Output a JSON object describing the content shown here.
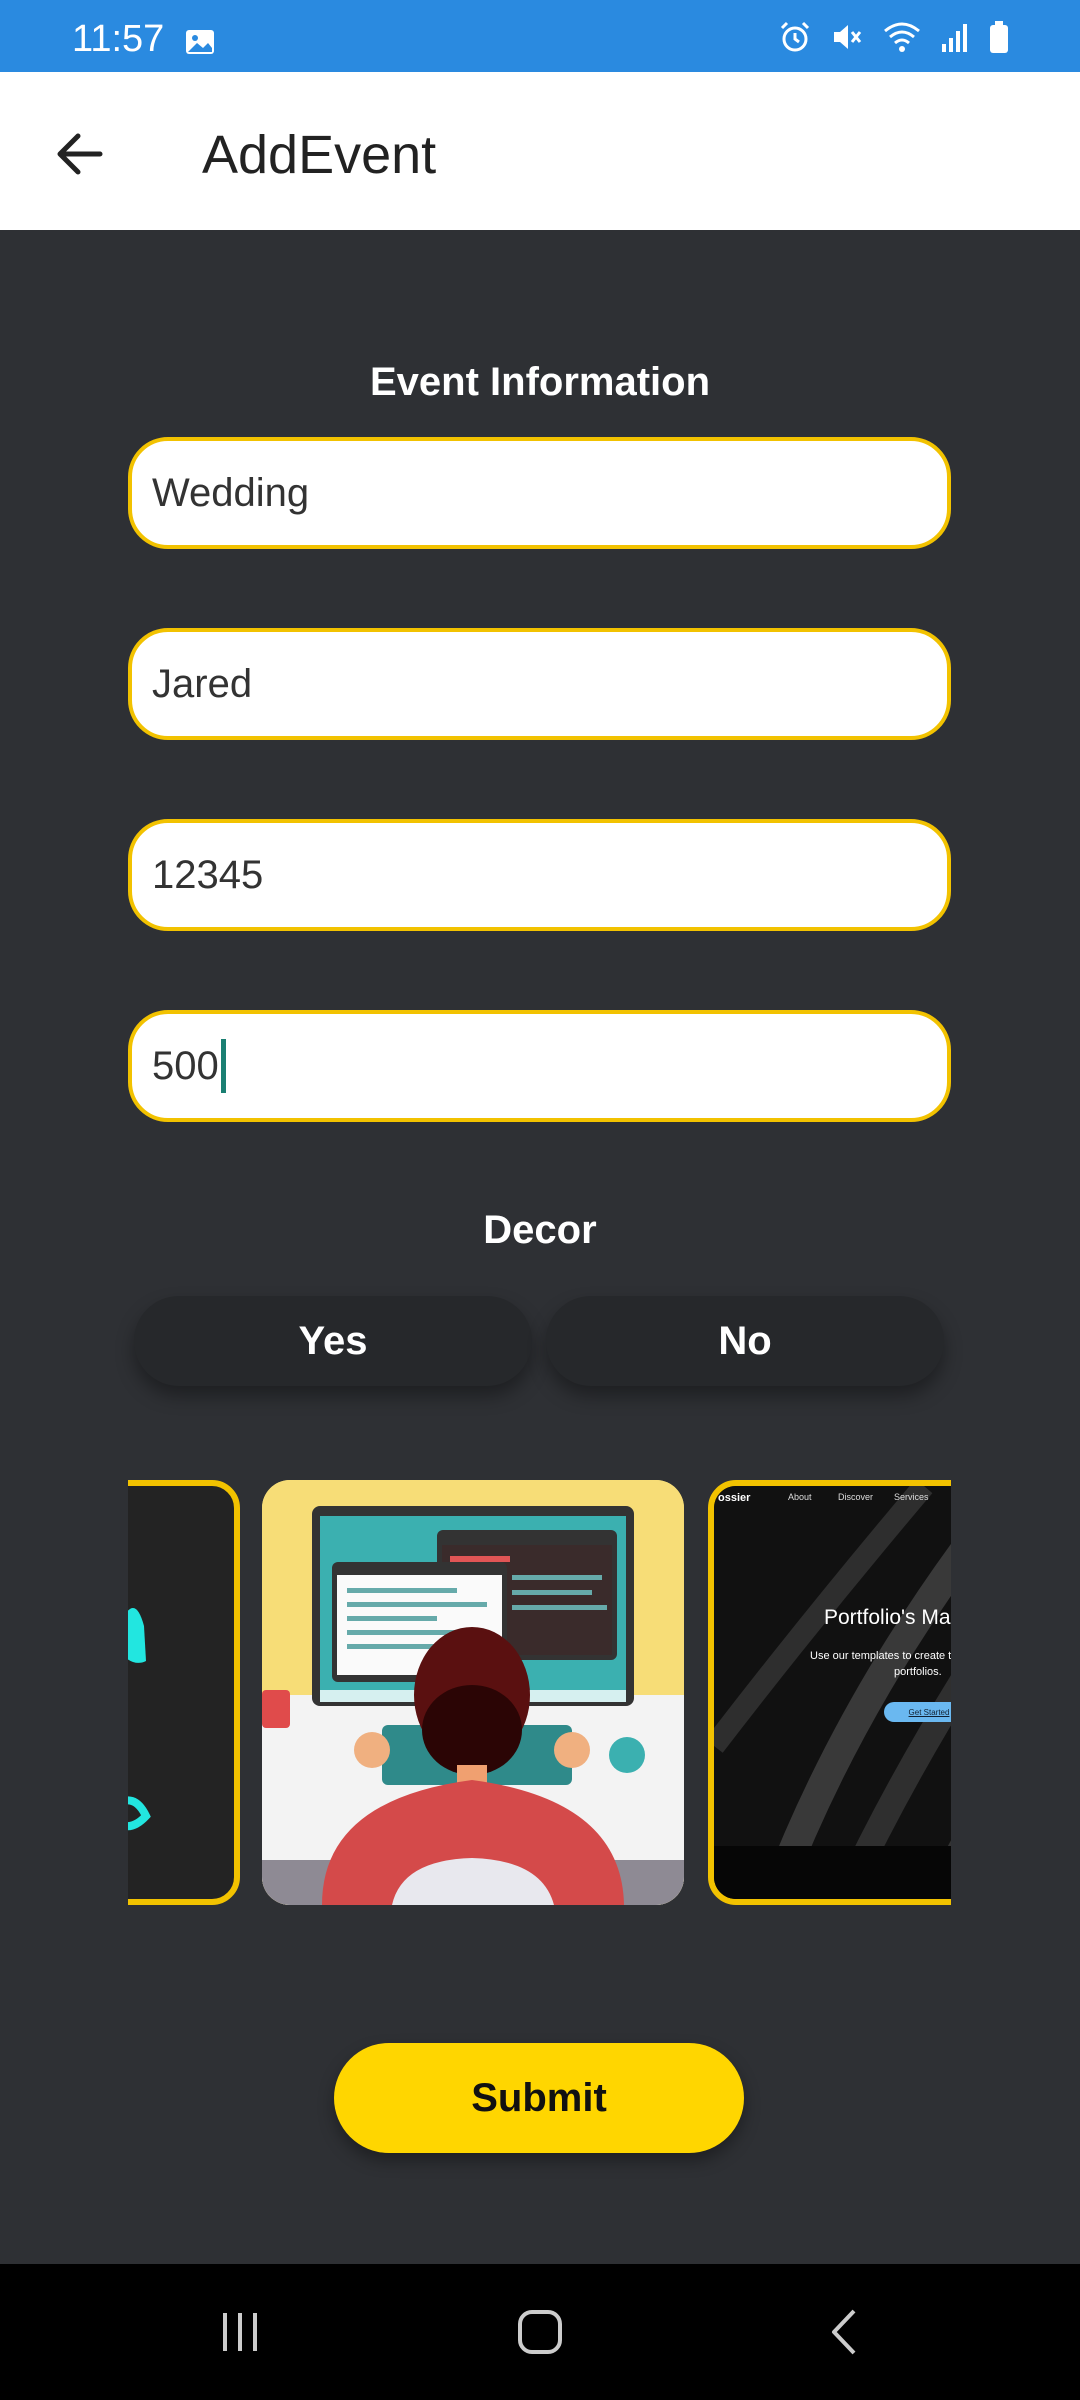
{
  "status_bar": {
    "time": "11:57",
    "icons": [
      "gallery-icon",
      "alarm-icon",
      "mute-icon",
      "wifi-icon",
      "signal-icon",
      "battery-icon"
    ]
  },
  "app_bar": {
    "title": "AddEvent",
    "back_icon": "arrow-left-icon"
  },
  "form": {
    "section_title": "Event Information",
    "fields": [
      {
        "value": "Wedding"
      },
      {
        "value": "Jared"
      },
      {
        "value": "12345"
      },
      {
        "value": "500"
      }
    ],
    "decor": {
      "label": "Decor",
      "options": [
        "Yes",
        "No"
      ]
    },
    "carousel": {
      "right_card": {
        "brand": "ossier",
        "nav": [
          "About",
          "Discover",
          "Services"
        ],
        "headline": "Portfolio's Ma",
        "subtitle_line1": "Use our templates to create th",
        "subtitle_line2": "portfolios.",
        "cta": "Get Started"
      }
    },
    "submit_label": "Submit"
  },
  "colors": {
    "status_bar": "#2a8ae0",
    "background": "#2e3034",
    "accent_yellow": "#ffd600",
    "field_border": "#f2c200"
  }
}
